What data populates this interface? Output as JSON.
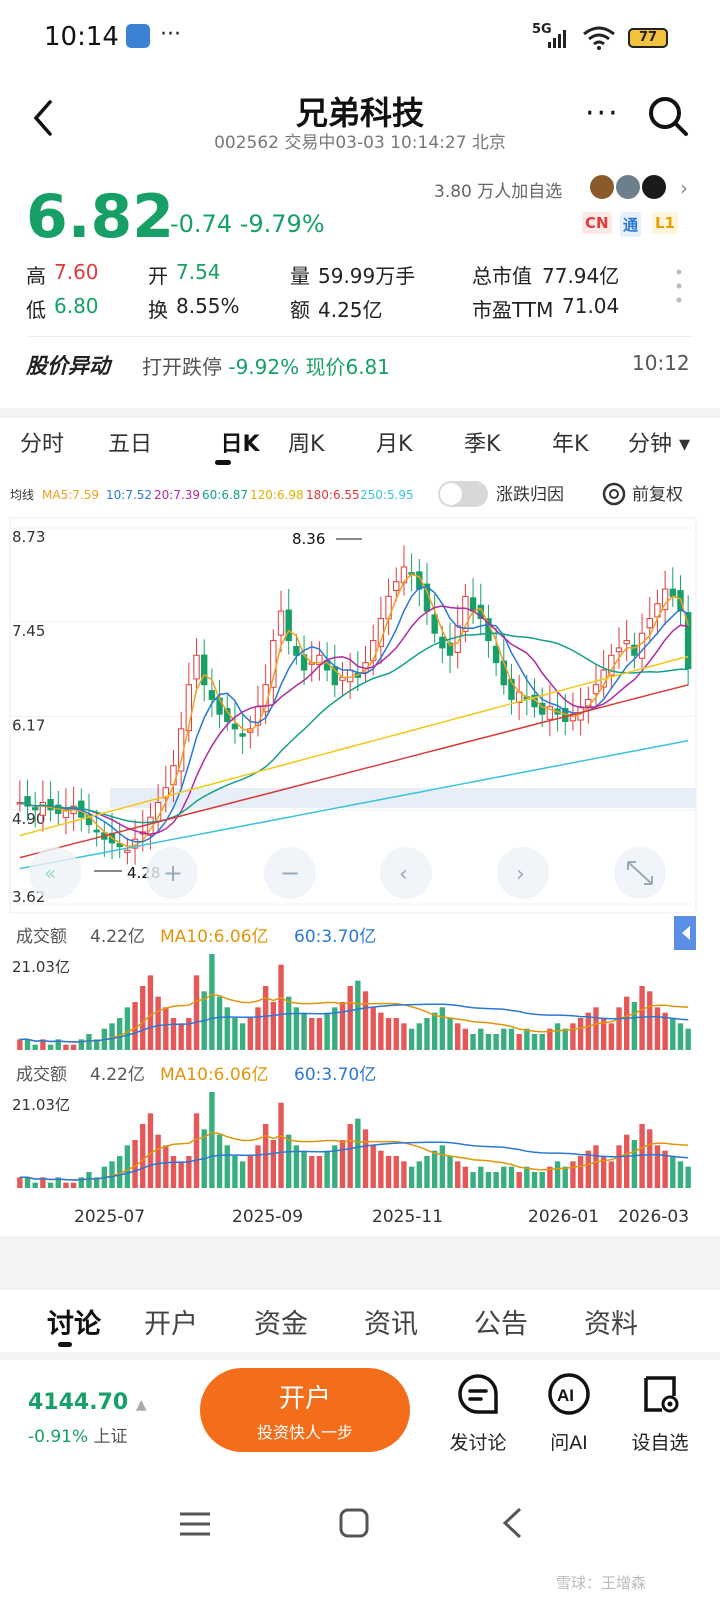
{
  "status_bar": {
    "time": "10:14",
    "dots": "···",
    "network": "5G",
    "battery": "77"
  },
  "header": {
    "title": "兄弟科技",
    "subtitle": "002562 交易中03-03 10:14:27 北京",
    "more": "···"
  },
  "quote": {
    "price": "6.82",
    "change": "-0.74 -9.79%",
    "followers": "3.80 万人加自选",
    "badges": [
      "CN",
      "通",
      "L1"
    ],
    "high_label": "高",
    "high": "7.60",
    "low_label": "低",
    "low": "6.80",
    "open_label": "开",
    "open": "7.54",
    "turnover_label": "换",
    "turnover": "8.55%",
    "volume_label": "量",
    "volume": "59.99万手",
    "amount_label": "额",
    "amount": "4.25亿",
    "mktcap_label": "总市值",
    "mktcap": "77.94亿",
    "pe_label": "市盈TTM",
    "pe": "71.04"
  },
  "alert": {
    "label": "股价异动",
    "text": "打开跌停",
    "value": "-9.92% 现价6.81",
    "time": "10:12"
  },
  "period_tabs": [
    "分时",
    "五日",
    "日K",
    "周K",
    "月K",
    "季K",
    "年K",
    "分钟 ▾"
  ],
  "chart_toolbar": {
    "ma_prefix": "均线",
    "ma_items": [
      "MA5:7.59",
      "10:7.52",
      "20:7.39",
      "60:6.87",
      "120:6.98",
      "180:6.55",
      "250:5.95"
    ],
    "toggle_label": "涨跌归因",
    "adjust_label": "前复权"
  },
  "volume_panel": {
    "label": "成交额",
    "value": "4.22亿",
    "ma10": "MA10:6.06亿",
    "ma60": "60:3.70亿",
    "ymax": "21.03亿"
  },
  "chart_data": {
    "type": "candlestick",
    "y_ticks": [
      "8.73",
      "7.45",
      "6.17",
      "4.90",
      "3.62"
    ],
    "ylim": [
      3.62,
      8.73
    ],
    "annotations": {
      "max": "8.36",
      "min": "4.28"
    },
    "x_ticks": [
      "2025-07",
      "2025-09",
      "2025-11",
      "2026-01",
      "2026-03"
    ],
    "close_series": [
      5.0,
      4.95,
      4.9,
      5.0,
      4.9,
      4.85,
      4.9,
      4.95,
      4.8,
      4.7,
      4.6,
      4.5,
      4.45,
      4.4,
      4.35,
      4.5,
      4.6,
      4.8,
      5.0,
      5.2,
      5.5,
      6.0,
      6.6,
      7.0,
      6.6,
      6.4,
      6.2,
      6.1,
      6.0,
      5.9,
      6.0,
      6.3,
      6.6,
      7.2,
      7.6,
      7.2,
      7.0,
      6.8,
      6.9,
      7.0,
      6.8,
      6.6,
      6.7,
      6.8,
      6.7,
      6.9,
      7.2,
      7.5,
      7.8,
      8.0,
      8.2,
      8.1,
      7.9,
      7.6,
      7.3,
      7.1,
      7.0,
      7.4,
      7.8,
      7.6,
      7.5,
      7.2,
      6.9,
      6.6,
      6.4,
      6.5,
      6.4,
      6.3,
      6.2,
      6.3,
      6.2,
      6.1,
      6.2,
      6.3,
      6.4,
      6.6,
      6.8,
      7.0,
      7.1,
      7.2,
      7.0,
      7.3,
      7.5,
      7.7,
      7.9,
      7.8,
      7.6,
      6.82
    ],
    "ma_lines": [
      {
        "name": "MA5",
        "color": "#f0a020"
      },
      {
        "name": "10",
        "color": "#2a78d6"
      },
      {
        "name": "20",
        "color": "#b02aa0"
      },
      {
        "name": "60",
        "color": "#15a08a"
      },
      {
        "name": "120",
        "color": "#f2c81a"
      },
      {
        "name": "180",
        "color": "#d83a3a"
      },
      {
        "name": "250",
        "color": "#38c3d8"
      }
    ],
    "volume_series": [
      2,
      2,
      1,
      2,
      1,
      2,
      1,
      1,
      2,
      3,
      2,
      4,
      5,
      6,
      8,
      9,
      12,
      14,
      10,
      8,
      6,
      5,
      6,
      14,
      11,
      18,
      10,
      8,
      6,
      5,
      6,
      8,
      12,
      9,
      16,
      10,
      8,
      7,
      6,
      6,
      7,
      8,
      9,
      12,
      13,
      11,
      8,
      7,
      6,
      6,
      5,
      4,
      5,
      6,
      7,
      8,
      6,
      5,
      4,
      3,
      4,
      3,
      3,
      4,
      4,
      3,
      4,
      3,
      3,
      4,
      5,
      4,
      5,
      6,
      7,
      8,
      6,
      5,
      8,
      10,
      9,
      12,
      11,
      8,
      7,
      6,
      5,
      4
    ]
  },
  "bottom_tabs": [
    "讨论",
    "开户",
    "资金",
    "资讯",
    "公告",
    "资料"
  ],
  "footer": {
    "index_value": "4144.70",
    "index_change": "-0.91%",
    "index_name": "上证",
    "open_account_title": "开户",
    "open_account_sub": "投资快人一步",
    "discuss_label": "发讨论",
    "ai_label": "问AI",
    "watch_label": "设自选"
  },
  "watermark": "雪球：王增森"
}
